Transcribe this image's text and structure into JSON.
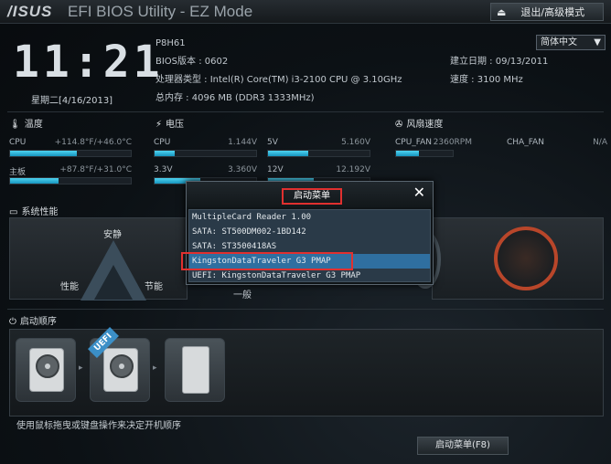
{
  "header": {
    "logo": "/ISUS",
    "app_title": "EFI BIOS Utility - EZ Mode",
    "exit_label": "退出/高级模式"
  },
  "clock": {
    "time": "11:21",
    "date": "星期二[4/16/2013]"
  },
  "sysinfo": {
    "model": "P8H61",
    "bios_version": "BIOS版本 : 0602",
    "cpu_type": "处理器类型 : Intel(R) Core(TM) i3-2100 CPU @ 3.10GHz",
    "memory": "总内存 : 4096 MB (DDR3 1333MHz)",
    "build_date": "建立日期 : 09/13/2011",
    "speed": "速度 : 3100 MHz"
  },
  "language": {
    "selected": "简体中文"
  },
  "temperature": {
    "title": "温度",
    "items": [
      {
        "name": "CPU",
        "value": "+114.8°F/+46.0°C",
        "level": 0.55
      },
      {
        "name": "主板",
        "value": "+87.8°F/+31.0°C",
        "level": 0.4
      }
    ]
  },
  "voltage": {
    "title": "电压",
    "items": [
      {
        "name": "CPU",
        "value": "1.144V",
        "level": 0.2
      },
      {
        "name": "3.3V",
        "value": "3.360V",
        "level": 0.45
      },
      {
        "name": "5V",
        "value": "5.160V",
        "level": 0.4
      },
      {
        "name": "12V",
        "value": "12.192V",
        "level": 0.45
      }
    ]
  },
  "fan": {
    "title": "风扇速度",
    "items": [
      {
        "name": "CPU_FAN",
        "value": "2360RPM",
        "level": 0.4
      },
      {
        "name": "CHA_FAN",
        "value": "N/A",
        "level": 0
      }
    ]
  },
  "performance": {
    "title": "系统性能",
    "quiet": "安静",
    "performance": "性能",
    "energy": "节能",
    "general": "一般"
  },
  "boot": {
    "title": "启动顺序",
    "hint": "使用鼠标拖曳或键盘操作来决定开机顺序",
    "uefi_tag": "UEFI",
    "menu_button": "启动菜单(F8)"
  },
  "boot_menu": {
    "title": "启动菜单",
    "close": "✕",
    "items": [
      {
        "label": "MultipleCard Reader 1.00",
        "selected": false
      },
      {
        "label": "SATA: ST500DM002-1BD142",
        "selected": false
      },
      {
        "label": "SATA: ST3500418AS",
        "selected": false
      },
      {
        "label": "KingstonDataTraveler G3 PMAP",
        "selected": true
      },
      {
        "label": "UEFI: KingstonDataTraveler G3 PMAP",
        "selected": false
      }
    ]
  },
  "colors": {
    "accent": "#1694be",
    "highlight": "#e0302f",
    "selected_row": "#2f6fa0"
  }
}
